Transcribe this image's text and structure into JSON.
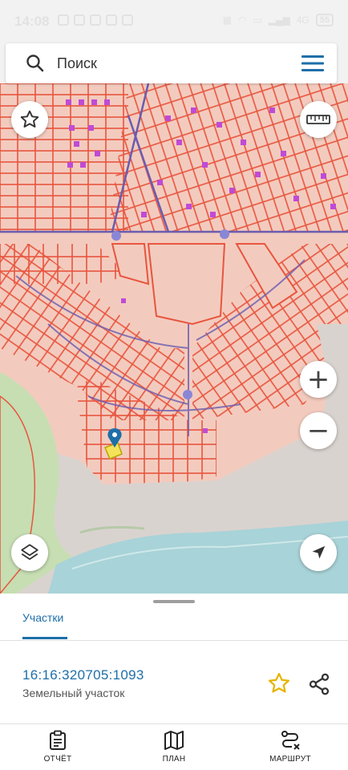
{
  "status_bar": {
    "time": "14:08",
    "network_label": "4G",
    "battery_level": "55"
  },
  "search": {
    "placeholder": "Поиск"
  },
  "map": {
    "zoom_in_label": "+",
    "zoom_out_label": "−"
  },
  "bottom_sheet": {
    "tab_label": "Участки",
    "cadastral_number": "16:16:320705:1093",
    "parcel_type": "Земельный участок"
  },
  "bottom_nav": {
    "report_label": "ОТЧЁТ",
    "plan_label": "ПЛАН",
    "route_label": "МАРШРУТ"
  },
  "colors": {
    "accent": "#1e6fa8",
    "parcel_line": "#e8553e",
    "map_fill": "#f3cbbe",
    "road": "#6a5cb0",
    "poi": "#c04ad6",
    "favorite": "#e6b400"
  }
}
